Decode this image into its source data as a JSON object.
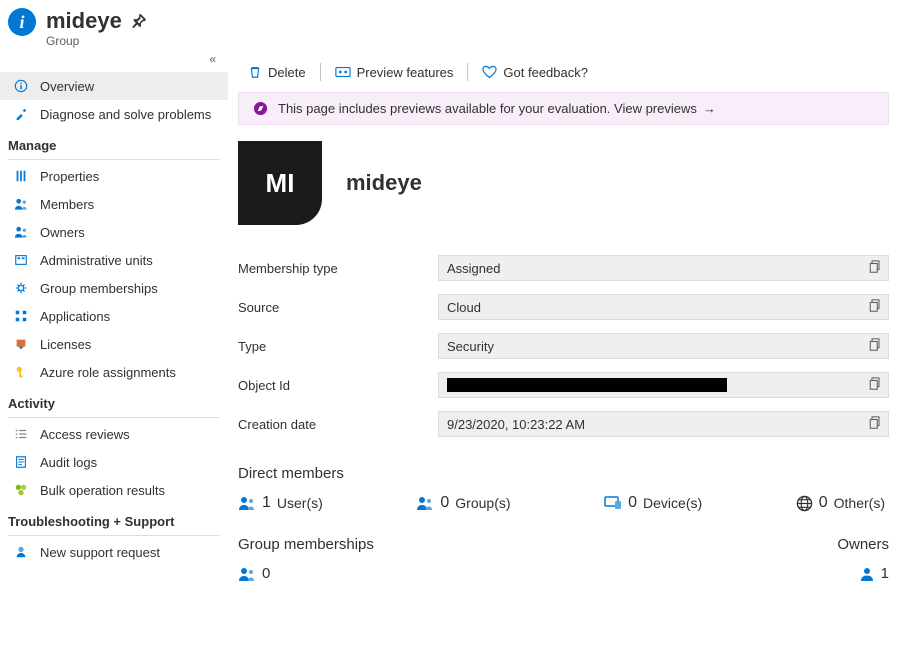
{
  "header": {
    "title": "mideye",
    "subtitle": "Group"
  },
  "toolbar": {
    "delete": "Delete",
    "preview": "Preview features",
    "feedback": "Got feedback?"
  },
  "banner": {
    "text": "This page includes previews available for your evaluation. View previews"
  },
  "sidebar": {
    "overview": "Overview",
    "diagnose": "Diagnose and solve problems",
    "manage_header": "Manage",
    "properties": "Properties",
    "members": "Members",
    "owners": "Owners",
    "admin_units": "Administrative units",
    "group_memberships": "Group memberships",
    "applications": "Applications",
    "licenses": "Licenses",
    "azure_roles": "Azure role assignments",
    "activity_header": "Activity",
    "access_reviews": "Access reviews",
    "audit_logs": "Audit logs",
    "bulk_results": "Bulk operation results",
    "troubleshoot_header": "Troubleshooting + Support",
    "support_request": "New support request"
  },
  "group": {
    "avatar_initials": "MI",
    "name": "mideye"
  },
  "properties": {
    "labels": {
      "membership_type": "Membership type",
      "source": "Source",
      "type": "Type",
      "object_id": "Object Id",
      "creation_date": "Creation date"
    },
    "values": {
      "membership_type": "Assigned",
      "source": "Cloud",
      "type": "Security",
      "creation_date": "9/23/2020, 10:23:22 AM"
    }
  },
  "direct_members": {
    "title": "Direct members",
    "users_count": "1",
    "users_label": "User(s)",
    "groups_count": "0",
    "groups_label": "Group(s)",
    "devices_count": "0",
    "devices_label": "Device(s)",
    "others_count": "0",
    "others_label": "Other(s)"
  },
  "group_memberships_section": {
    "title": "Group memberships",
    "count": "0"
  },
  "owners_section": {
    "title": "Owners",
    "count": "1"
  }
}
